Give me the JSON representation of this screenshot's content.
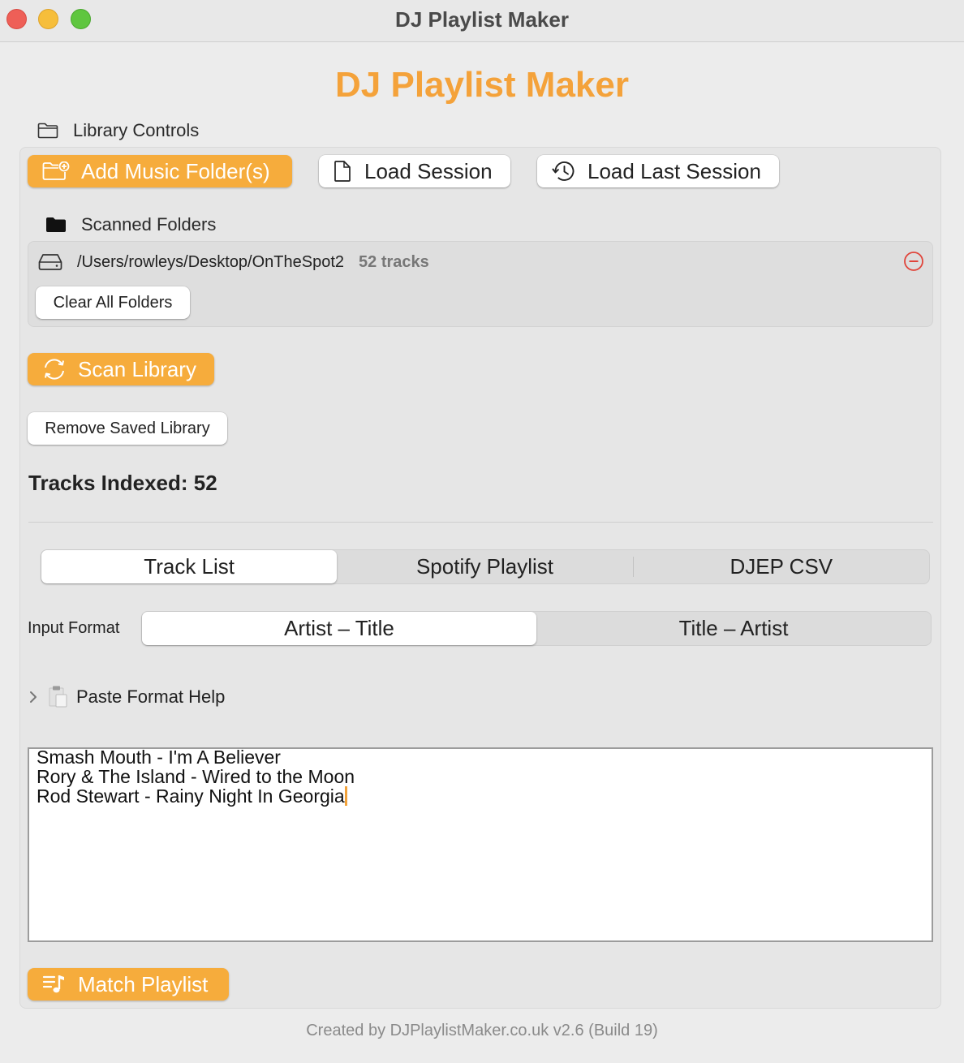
{
  "window": {
    "title": "DJ Playlist Maker"
  },
  "app": {
    "title": "DJ Playlist Maker",
    "accent_color": "#f4a23a"
  },
  "library": {
    "section_label": "Library Controls",
    "section_icon": "folder-icon",
    "add_folder_label": "Add Music Folder(s)",
    "load_session_label": "Load Session",
    "load_last_session_label": "Load Last Session",
    "scanned_folders_label": "Scanned Folders",
    "folders": [
      {
        "path": "/Users/rowleys/Desktop/OnTheSpot2",
        "count": "52 tracks"
      }
    ],
    "clear_all_label": "Clear All Folders",
    "scan_label": "Scan Library",
    "remove_saved_label": "Remove Saved Library",
    "tracks_indexed": "Tracks Indexed: 52"
  },
  "source_tabs": {
    "tabs": [
      {
        "label": "Track List",
        "active": true
      },
      {
        "label": "Spotify Playlist",
        "active": false
      },
      {
        "label": "DJEP CSV",
        "active": false
      }
    ]
  },
  "input_format": {
    "label": "Input Format",
    "options": [
      {
        "label": "Artist – Title",
        "active": true
      },
      {
        "label": "Title – Artist",
        "active": false
      }
    ]
  },
  "help": {
    "label": "Paste Format Help"
  },
  "track_input": {
    "lines": [
      "Smash Mouth - I'm A Believer",
      "Rory & The Island - Wired to the Moon",
      "Rod Stewart - Rainy Night In Georgia"
    ]
  },
  "match": {
    "label": "Match Playlist"
  },
  "footer": {
    "text": "Created by DJPlaylistMaker.co.uk v2.6 (Build 19)"
  }
}
